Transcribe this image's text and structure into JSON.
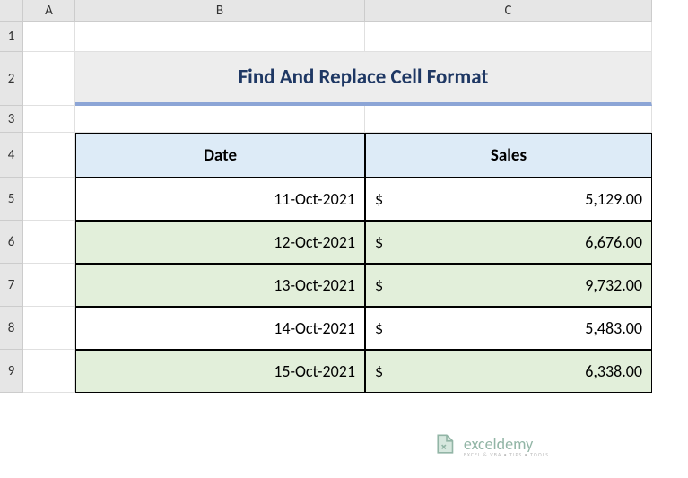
{
  "columns": {
    "A": "A",
    "B": "B",
    "C": "C"
  },
  "rows": [
    "1",
    "2",
    "3",
    "4",
    "5",
    "6",
    "7",
    "8",
    "9"
  ],
  "title": "Find And Replace Cell Format",
  "headers": {
    "date": "Date",
    "sales": "Sales"
  },
  "data": [
    {
      "date": "11-Oct-2021",
      "currency": "$",
      "amount": "5,129.00",
      "highlight": false
    },
    {
      "date": "12-Oct-2021",
      "currency": "$",
      "amount": "6,676.00",
      "highlight": true
    },
    {
      "date": "13-Oct-2021",
      "currency": "$",
      "amount": "9,732.00",
      "highlight": true
    },
    {
      "date": "14-Oct-2021",
      "currency": "$",
      "amount": "5,483.00",
      "highlight": false
    },
    {
      "date": "15-Oct-2021",
      "currency": "$",
      "amount": "6,338.00",
      "highlight": true
    }
  ],
  "watermark": {
    "main": "exceldemy",
    "sub": "EXCEL & VBA • TIPS • TOOLS"
  },
  "dimensions": {
    "colA": 58,
    "colB": 323,
    "colC": 320,
    "row1": 34,
    "row2": 60,
    "row3": 30,
    "rowHeader": 50,
    "rowData": 48
  }
}
